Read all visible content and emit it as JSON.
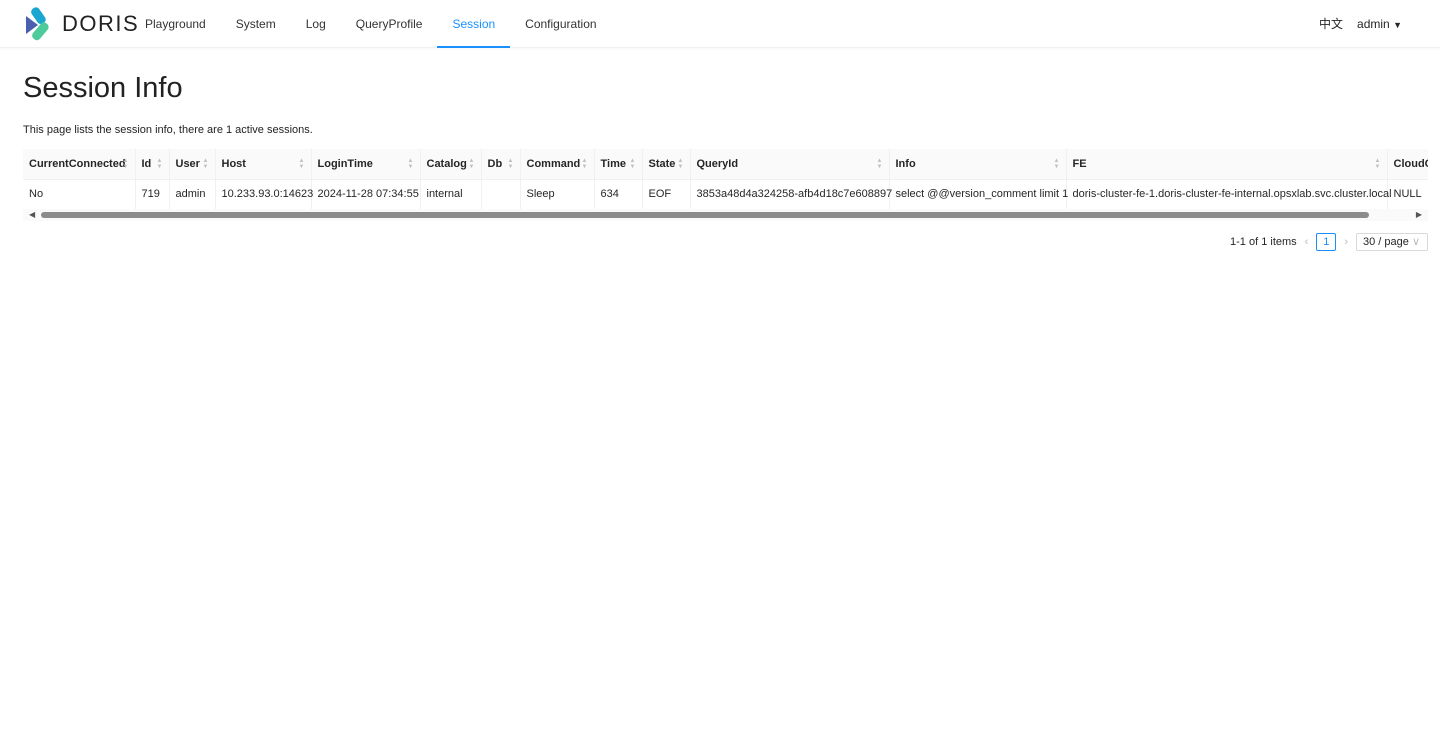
{
  "brand": "DORIS",
  "nav": [
    {
      "label": "Playground"
    },
    {
      "label": "System"
    },
    {
      "label": "Log"
    },
    {
      "label": "QueryProfile"
    },
    {
      "label": "Session",
      "active": true
    },
    {
      "label": "Configuration"
    }
  ],
  "lang": "中文",
  "user": "admin",
  "title": "Session Info",
  "description": "This page lists the session info, there are 1 active sessions.",
  "table": {
    "columns": [
      "CurrentConnected",
      "Id",
      "User",
      "Host",
      "LoginTime",
      "Catalog",
      "Db",
      "Command",
      "Time",
      "State",
      "QueryId",
      "Info",
      "FE",
      "CloudCluster"
    ],
    "rows": [
      [
        "No",
        "719",
        "admin",
        "10.233.93.0:14623",
        "2024-11-28 07:34:55",
        "internal",
        "",
        "Sleep",
        "634",
        "EOF",
        "3853a48d4a324258-afb4d18c7e608897",
        "select @@version_comment limit 1",
        "doris-cluster-fe-1.doris-cluster-fe-internal.opsxlab.svc.cluster.local",
        "NULL"
      ]
    ]
  },
  "pagination": {
    "summary": "1-1 of 1 items",
    "current": "1",
    "page_size": "30 / page"
  },
  "colors": {
    "accent": "#1890ff"
  }
}
